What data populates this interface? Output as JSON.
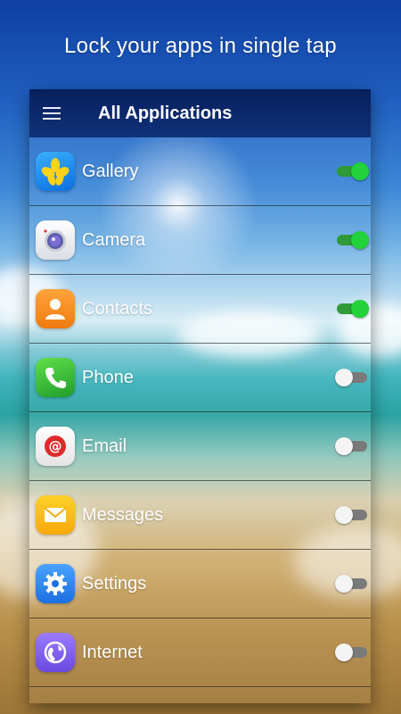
{
  "headline": "Lock your apps in single tap",
  "appbar": {
    "title": "All Applications",
    "menu_icon": "menu-icon"
  },
  "apps": [
    {
      "label": "Gallery",
      "icon": "gallery-icon",
      "locked": true
    },
    {
      "label": "Camera",
      "icon": "camera-icon",
      "locked": true
    },
    {
      "label": "Contacts",
      "icon": "contacts-icon",
      "locked": true
    },
    {
      "label": "Phone",
      "icon": "phone-icon",
      "locked": false
    },
    {
      "label": "Email",
      "icon": "email-icon",
      "locked": false
    },
    {
      "label": "Messages",
      "icon": "messages-icon",
      "locked": false
    },
    {
      "label": "Settings",
      "icon": "settings-icon",
      "locked": false
    },
    {
      "label": "Internet",
      "icon": "internet-icon",
      "locked": false
    }
  ],
  "colors": {
    "toggle_on": "#22d23b",
    "toggle_off": "#f4f4f4",
    "appbar": "#0a2a6e"
  }
}
